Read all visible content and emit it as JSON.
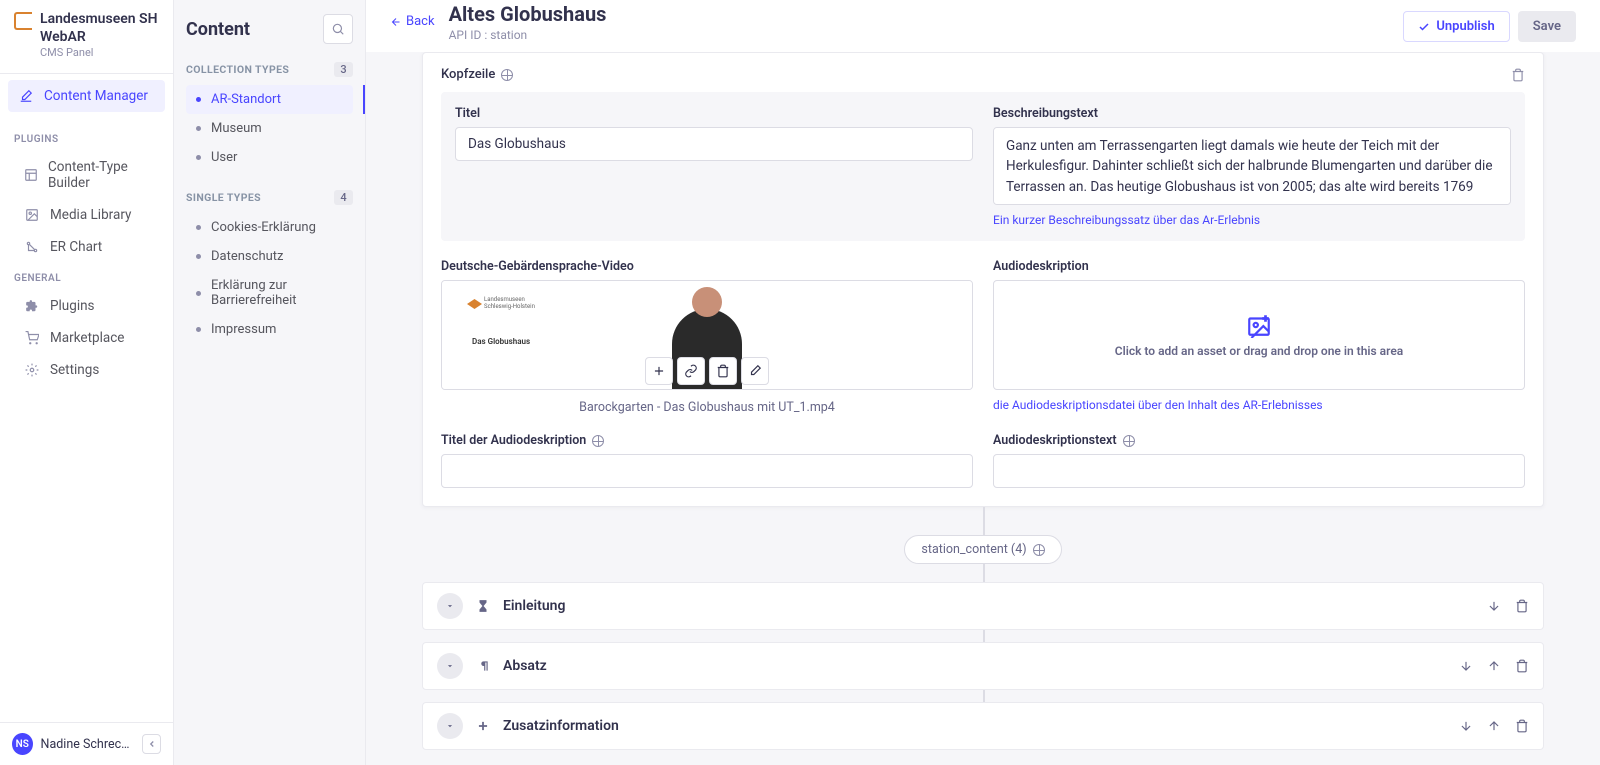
{
  "workspace": {
    "title": "Landesmuseen SH WebAR",
    "subtitle": "CMS Panel"
  },
  "nav1": {
    "items": [
      {
        "icon": "edit",
        "label": "Content Manager",
        "active": true
      }
    ],
    "plugins_label": "PLUGINS",
    "plugins": [
      {
        "icon": "layout",
        "label": "Content-Type Builder"
      },
      {
        "icon": "image",
        "label": "Media Library"
      },
      {
        "icon": "chart",
        "label": "ER Chart"
      }
    ],
    "general_label": "GENERAL",
    "general": [
      {
        "icon": "puzzle",
        "label": "Plugins"
      },
      {
        "icon": "cart",
        "label": "Marketplace"
      },
      {
        "icon": "gear",
        "label": "Settings"
      }
    ]
  },
  "user": {
    "initials": "NS",
    "name": "Nadine Schrecken"
  },
  "nav2": {
    "title": "Content",
    "collection_label": "COLLECTION TYPES",
    "collection_count": "3",
    "collection": [
      {
        "label": "AR-Standort",
        "active": true
      },
      {
        "label": "Museum"
      },
      {
        "label": "User"
      }
    ],
    "single_label": "SINGLE TYPES",
    "single_count": "4",
    "single": [
      {
        "label": "Cookies-Erklärung"
      },
      {
        "label": "Datenschutz"
      },
      {
        "label": "Erklärung zur Barrierefreiheit"
      },
      {
        "label": "Impressum"
      }
    ]
  },
  "page": {
    "back": "Back",
    "title": "Altes Globushaus",
    "api_id": "API ID : station",
    "unpublish": "Unpublish",
    "save": "Save"
  },
  "kopfzeile": {
    "label": "Kopfzeile",
    "titel_label": "Titel",
    "titel_value": "Das Globushaus",
    "beschreib_label": "Beschreibungstext",
    "beschreib_value": "Ganz unten am Terrassengarten liegt damals wie heute der Teich mit der Herkulesfigur. Dahinter schließt sich der halbrunde Blumengarten und darüber die Terrassen an. Das heutige Globushaus ist von 2005; das alte wird bereits 1769",
    "beschreib_hint": "Ein kurzer Beschreibungssatz über das Ar-Erlebnis",
    "dgs_label": "Deutsche-Gebärdensprache-Video",
    "dgs_inner": "Das Globushaus",
    "dgs_filename": "Barockgarten - Das Globushaus mit UT_1.mp4",
    "audio_label": "Audiodeskription",
    "audio_drop": "Click to add an asset or drag and drop one in this area",
    "audio_hint": "die Audiodeskriptionsdatei über den Inhalt des AR-Erlebnisses",
    "titel_audio_label": "Titel der Audiodeskription",
    "audiotext_label": "Audiodeskriptionstext"
  },
  "station_content": {
    "label": "station_content (4)",
    "blocks": [
      {
        "icon": "hourglass",
        "title": "Einleitung",
        "down": true,
        "up": false
      },
      {
        "icon": "paragraph",
        "title": "Absatz",
        "down": true,
        "up": true
      },
      {
        "icon": "plus",
        "title": "Zusatzinformation",
        "down": true,
        "up": true
      }
    ]
  }
}
